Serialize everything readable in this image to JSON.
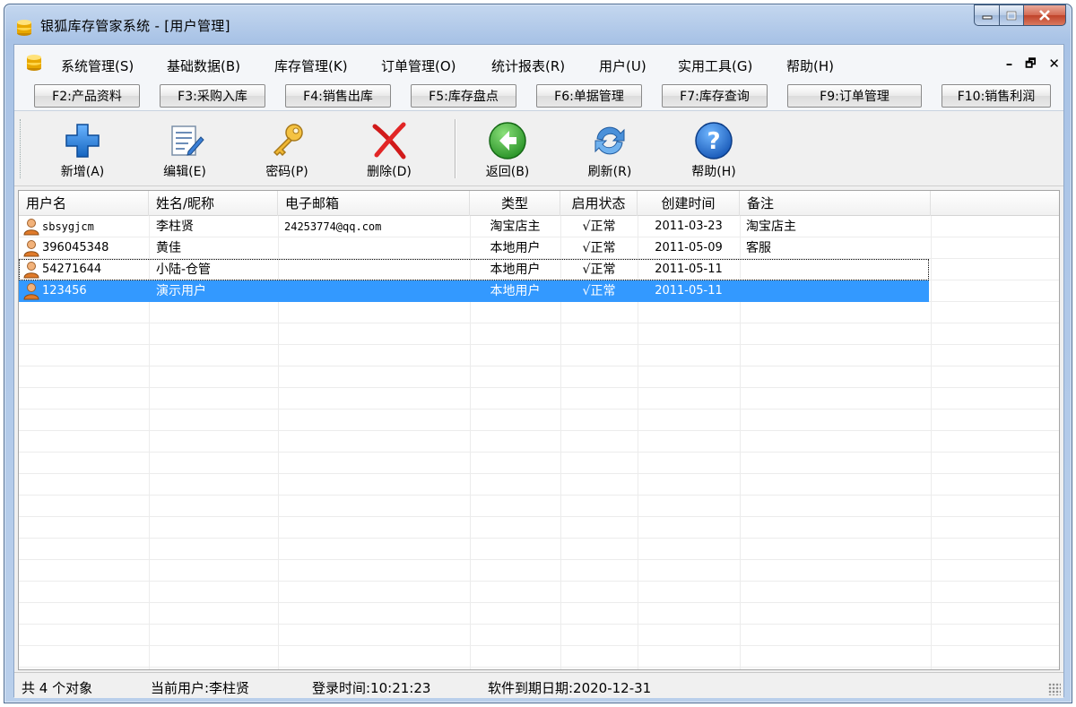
{
  "window": {
    "title": "银狐库存管家系统 - [用户管理]"
  },
  "menu": {
    "items": [
      "系统管理(S)",
      "基础数据(B)",
      "库存管理(K)",
      "订单管理(O)",
      "统计报表(R)",
      "用户(U)",
      "实用工具(G)",
      "帮助(H)"
    ],
    "mdi_min": "–",
    "mdi_restore": "🗗",
    "mdi_close": "✕"
  },
  "fkeys": [
    "F2:产品资料",
    "F3:采购入库",
    "F4:销售出库",
    "F5:库存盘点",
    "F6:单据管理",
    "F7:库存查询",
    "F9:订单管理",
    "F10:销售利润"
  ],
  "toolbar": {
    "add": "新增(A)",
    "edit": "编辑(E)",
    "password": "密码(P)",
    "delete": "删除(D)",
    "back": "返回(B)",
    "refresh": "刷新(R)",
    "help": "帮助(H)"
  },
  "table": {
    "headers": [
      "用户名",
      "姓名/昵称",
      "电子邮箱",
      "类型",
      "启用状态",
      "创建时间",
      "备注"
    ],
    "rows": [
      [
        "sbsygjcm",
        "李柱贤",
        "24253774@qq.com",
        "淘宝店主",
        "√正常",
        "2011-03-23",
        "淘宝店主"
      ],
      [
        "396045348",
        "黄佳",
        "",
        "本地用户",
        "√正常",
        "2011-05-09",
        "客服"
      ],
      [
        "54271644",
        "小陆-仓管",
        "",
        "本地用户",
        "√正常",
        "2011-05-11",
        ""
      ],
      [
        "123456",
        "演示用户",
        "",
        "本地用户",
        "√正常",
        "2011-05-11",
        ""
      ]
    ]
  },
  "status": {
    "count": "共 4 个对象",
    "current_user": "当前用户:李柱贤",
    "login_time": "登录时间:10:21:23",
    "expiry": "软件到期日期:2020-12-31"
  },
  "colors": {
    "selection": "#3399ff",
    "title_bar": "#b9cfeb"
  }
}
